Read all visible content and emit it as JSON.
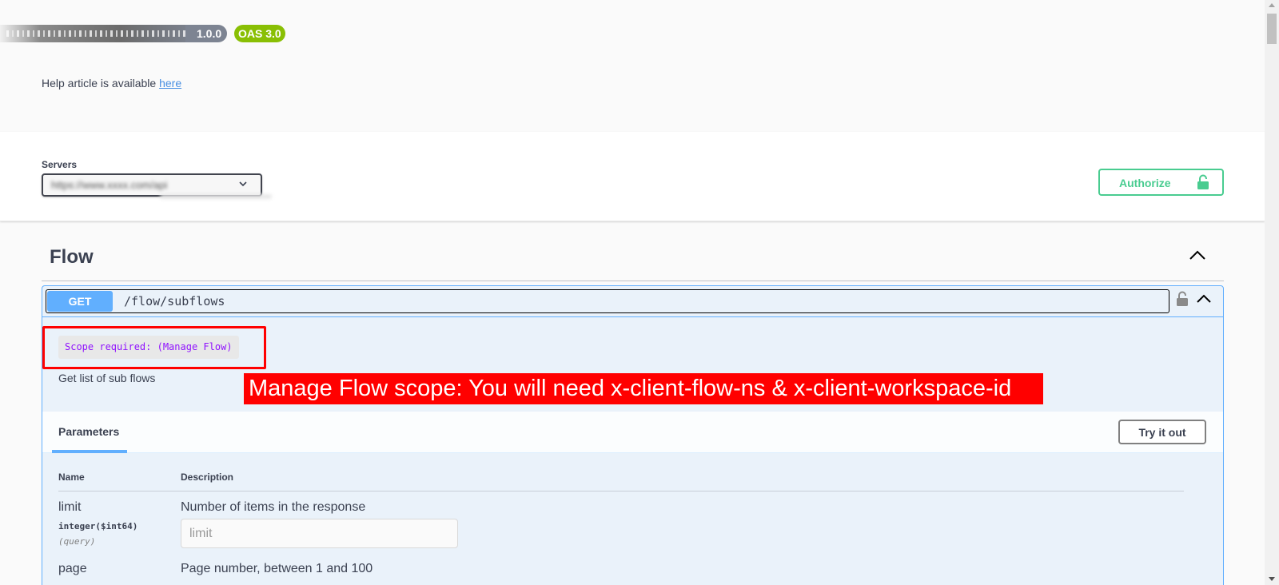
{
  "info": {
    "version": "1.0.0",
    "oas": "OAS 3.0",
    "help_text": "Help article is available ",
    "help_link": "here"
  },
  "scheme": {
    "servers_label": "Servers",
    "selected_server": "https://www.xxxx.com/api",
    "authorize_label": "Authorize"
  },
  "tag": {
    "name": "Flow"
  },
  "operation": {
    "method": "GET",
    "path": "/flow/subflows",
    "scope": "Scope required: (Manage Flow)",
    "description": "Get list of sub flows",
    "annotation": "Manage Flow scope: You will need x-client-flow-ns & x-client-workspace-id",
    "params_tab": "Parameters",
    "try_label": "Try it out",
    "col_name": "Name",
    "col_desc": "Description",
    "params": [
      {
        "name": "limit",
        "type": "integer($int64)",
        "in": "(query)",
        "description": "Number of items in the response",
        "placeholder": "limit"
      },
      {
        "name": "page",
        "type": "",
        "in": "",
        "description": "Page number, between 1 and 100",
        "placeholder": ""
      }
    ]
  },
  "colors": {
    "get": "#61affe",
    "authorize": "#49cc90",
    "oas": "#89bf04",
    "annotation": "#ff0000",
    "scope_text": "#9012fe"
  },
  "icons": [
    "lock-icon",
    "chevron-up-icon",
    "chevron-down-icon",
    "unlock-icon"
  ]
}
